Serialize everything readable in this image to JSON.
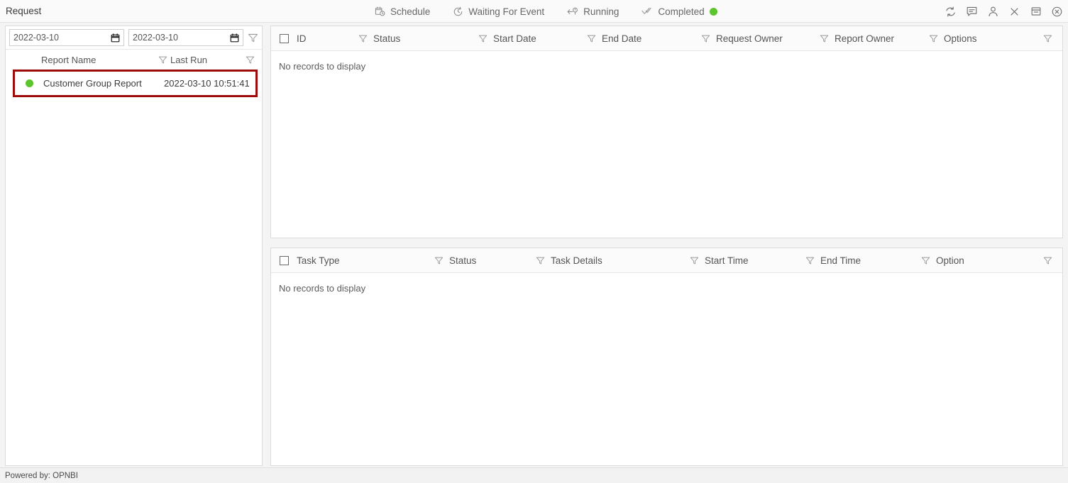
{
  "header": {
    "title": "Request",
    "nav": [
      {
        "label": "Schedule",
        "icon": "calendar-clock-icon",
        "dot": false
      },
      {
        "label": "Waiting For Event",
        "icon": "clock-icon",
        "dot": false
      },
      {
        "label": "Running",
        "icon": "arrow-clock-icon",
        "dot": false
      },
      {
        "label": "Completed",
        "icon": "double-check-icon",
        "dot": true
      }
    ],
    "icons": [
      "refresh-icon",
      "comment-icon",
      "user-icon",
      "close-icon",
      "window-icon",
      "circle-close-icon"
    ]
  },
  "colors": {
    "status_green": "#5cc42c",
    "highlight_border": "#9e0b0b",
    "page_background": "#f4f4f4"
  },
  "left_panel": {
    "date_from": {
      "value": "2022-03-10",
      "placeholder": "yyyy-mm-dd"
    },
    "date_to": {
      "value": "2022-03-10",
      "placeholder": "yyyy-mm-dd"
    },
    "filter_icon": "filter-funnel-icon",
    "columns": [
      "Report Name",
      "Last Run"
    ],
    "rows": [
      {
        "status": "completed",
        "report_name": "Customer Group Report",
        "last_run": "2022-03-10 10:51:41",
        "highlighted": true
      }
    ]
  },
  "request_grid": {
    "columns": [
      "ID",
      "Status",
      "Start Date",
      "End Date",
      "Request Owner",
      "Report Owner",
      "Options"
    ],
    "empty_text": "No records to display"
  },
  "task_grid": {
    "columns": [
      "Task Type",
      "Status",
      "Task Details",
      "Start Time",
      "End Time",
      "Option"
    ],
    "empty_text": "No records to display"
  },
  "footer": {
    "text": "Powered by: OPNBI"
  }
}
